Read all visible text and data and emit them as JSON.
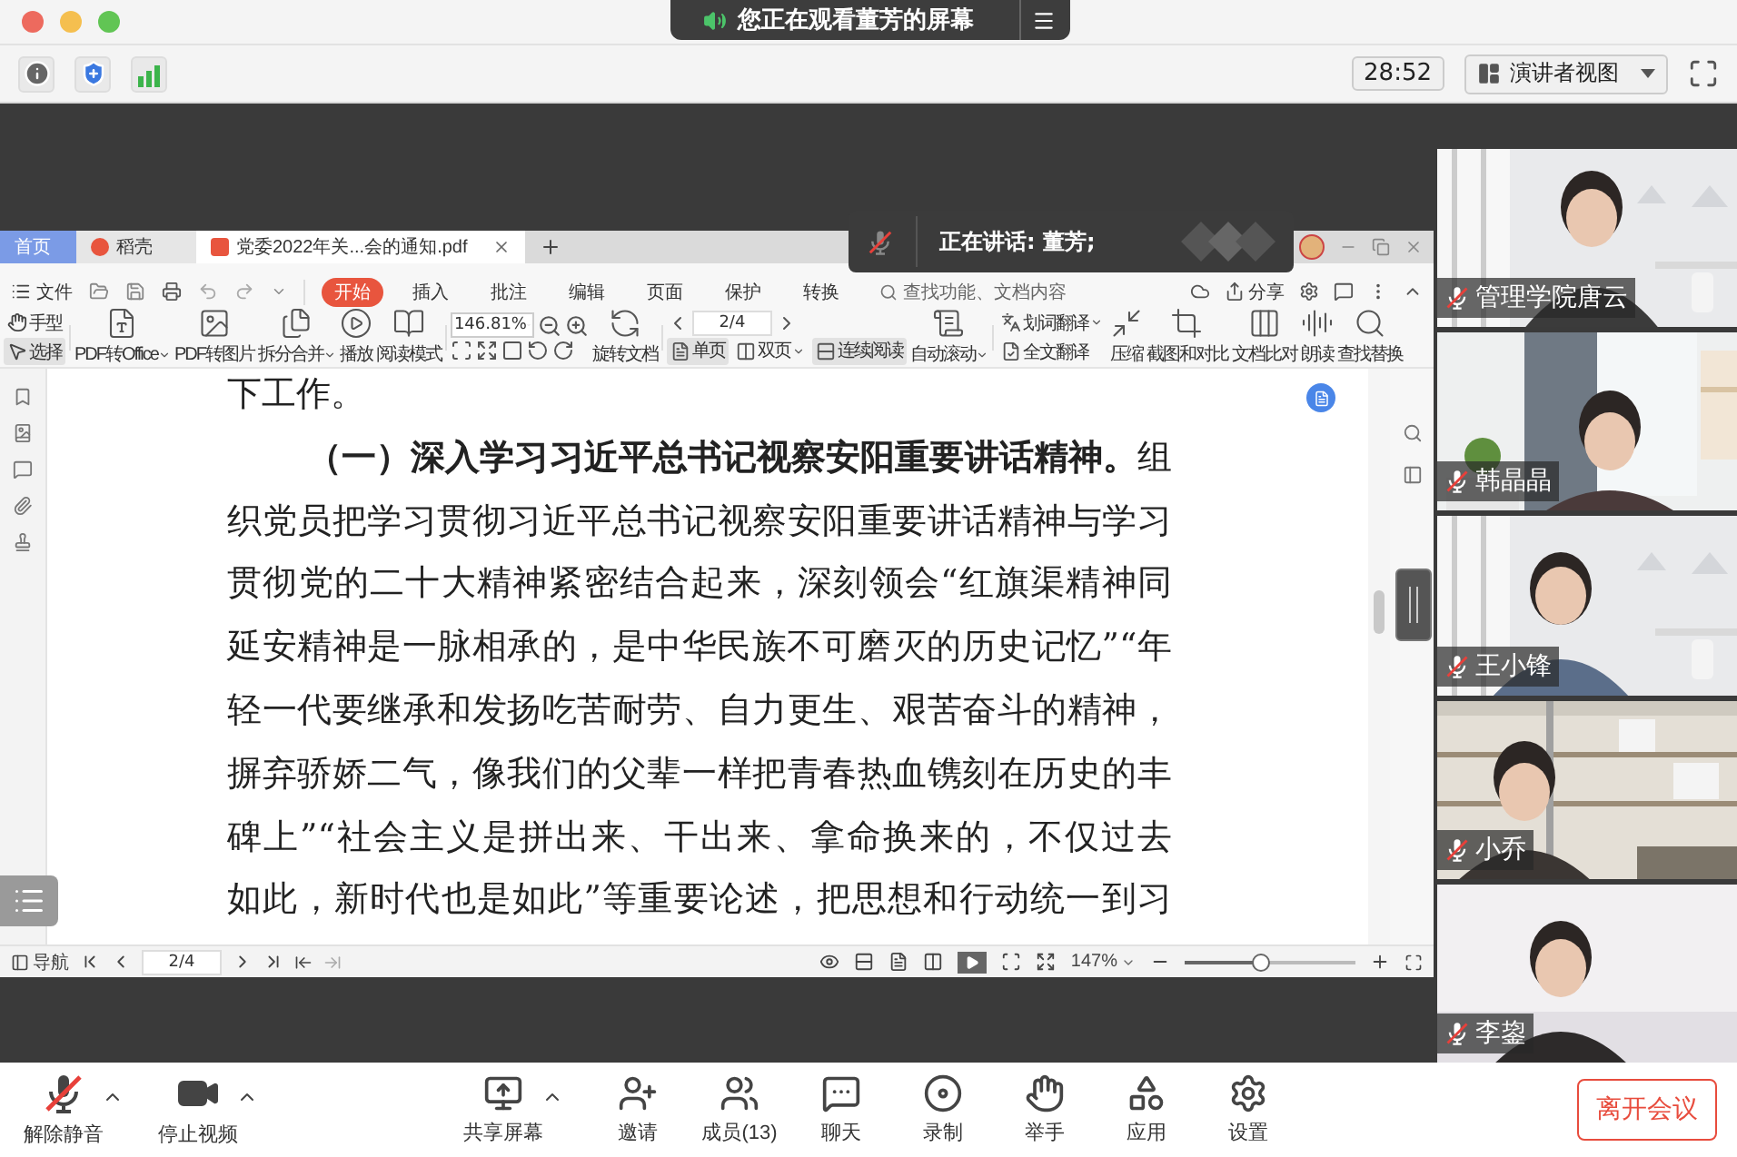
{
  "title_bar": {
    "share_notice": "您正在观看董芳的屏幕"
  },
  "toolbar": {
    "timer": "28:52",
    "view_mode": "演讲者视图"
  },
  "speaker": {
    "label": "正在讲话: 董芳;",
    "muted": true
  },
  "wps": {
    "tabs": [
      {
        "label": "首页",
        "kind": "home",
        "selected": false
      },
      {
        "label": "稻壳",
        "kind": "docer",
        "selected": false
      },
      {
        "label": "党委2022年关...会的通知.pdf",
        "kind": "pdf",
        "selected": true
      }
    ],
    "file_menu": "文件",
    "menu": [
      {
        "label": "开始",
        "selected": true
      },
      {
        "label": "插入",
        "selected": false
      },
      {
        "label": "批注",
        "selected": false
      },
      {
        "label": "编辑",
        "selected": false
      },
      {
        "label": "页面",
        "selected": false
      },
      {
        "label": "保护",
        "selected": false
      },
      {
        "label": "转换",
        "selected": false
      }
    ],
    "search": {
      "placeholder": "查找功能、文档内容"
    },
    "share": "分享",
    "ribbon": {
      "pointer_tools": [
        {
          "label": "手型",
          "selected": false
        },
        {
          "label": "选择",
          "selected": true
        }
      ],
      "convert_tools": [
        {
          "label": "PDF转Office",
          "dropdown": true
        },
        {
          "label": "PDF转图片",
          "dropdown": false
        },
        {
          "label": "拆分合并",
          "dropdown": true
        },
        {
          "label": "播放",
          "dropdown": false
        },
        {
          "label": "阅读模式",
          "dropdown": false
        }
      ],
      "zoom": "146.81%",
      "rotate_tool": "旋转文档",
      "page_field": "2/4",
      "view_modes": [
        {
          "label": "单页",
          "selected": true,
          "dropdown": false
        },
        {
          "label": "双页",
          "selected": false,
          "dropdown": true
        },
        {
          "label": "连续阅读",
          "selected": true,
          "dropdown": false
        }
      ],
      "auto_scroll": {
        "label": "自动滚动",
        "dropdown": true
      },
      "translate_tools": [
        {
          "label": "划词翻译",
          "dropdown": true
        },
        {
          "label": "全文翻译",
          "dropdown": false
        }
      ],
      "extra_tools": [
        "压缩",
        "截图和对比",
        "文档比对",
        "朗读",
        "查找替换"
      ]
    },
    "lines": [
      {
        "text": "下工作。",
        "kind": "end"
      },
      {
        "text": "**（一）深入学习习近平总书记视察安阳重要讲话精神。**组",
        "kind": "indent"
      },
      {
        "text": "织党员把学习贯彻习近平总书记视察安阳重要讲话精神与学习",
        "kind": "full"
      },
      {
        "text": "贯彻党的二十大精神紧密结合起来，深刻领会“红旗渠精神同",
        "kind": "full"
      },
      {
        "text": "延安精神是一脉相承的，是中华民族不可磨灭的历史记忆”“年",
        "kind": "full"
      },
      {
        "text": "轻一代要继承和发扬吃苦耐劳、自力更生、艰苦奋斗的精神，",
        "kind": "full"
      },
      {
        "text": "摒弃骄娇二气，像我们的父辈一样把青春热血镌刻在历史的丰",
        "kind": "full"
      },
      {
        "text": "碑上”“社会主义是拼出来、干出来、拿命换来的，不仅过去",
        "kind": "full"
      },
      {
        "text": "如此，新时代也是如此”等重要论述，把思想和行动统一到习",
        "kind": "full"
      }
    ],
    "status": {
      "nav": "导航",
      "page": "2/4",
      "zoom": "147%",
      "zoom_slider": {
        "level": 0.45
      }
    }
  },
  "participants": [
    {
      "name": "管理学院唐云",
      "muted": true
    },
    {
      "name": "韩晶晶",
      "muted": true
    },
    {
      "name": "王小锋",
      "muted": true
    },
    {
      "name": "小乔",
      "muted": true
    },
    {
      "name": "李鋆",
      "muted": true
    }
  ],
  "bottom_bar": {
    "items": [
      {
        "label": "解除静音",
        "kind": "mic",
        "muted": true,
        "menu": true
      },
      {
        "label": "停止视频",
        "kind": "camera",
        "video_on": true,
        "menu": true
      },
      {
        "label": "共享屏幕",
        "kind": "share",
        "menu": true
      },
      {
        "label": "邀请",
        "kind": "invite",
        "menu": false
      },
      {
        "label": "成员(13)",
        "kind": "members",
        "menu": false
      },
      {
        "label": "聊天",
        "kind": "chat",
        "menu": false
      },
      {
        "label": "录制",
        "kind": "record",
        "menu": false
      },
      {
        "label": "举手",
        "kind": "hand",
        "menu": false
      },
      {
        "label": "应用",
        "kind": "apps",
        "menu": false
      },
      {
        "label": "设置",
        "kind": "settings",
        "menu": false
      }
    ],
    "leave": "离开会议"
  }
}
